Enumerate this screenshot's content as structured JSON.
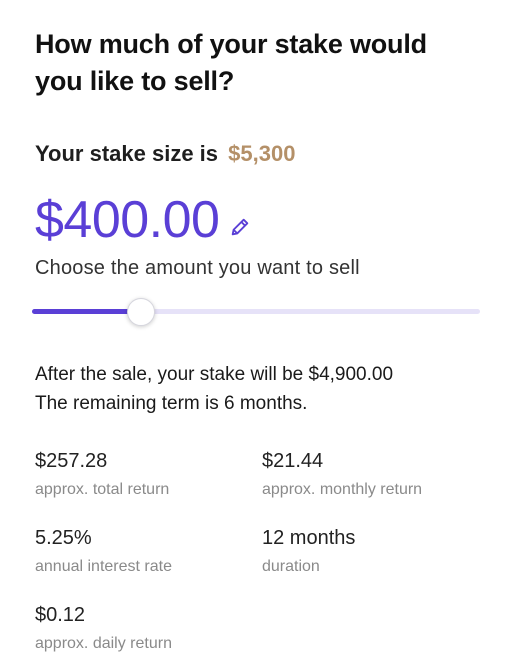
{
  "heading": "How much of your stake would you like to sell?",
  "stake": {
    "label": "Your stake size is",
    "value": "$5,300"
  },
  "amount": {
    "value": "$400.00",
    "edit_icon": "pencil-icon"
  },
  "slider": {
    "label": "Choose the amount you want to sell",
    "fraction": 0.24
  },
  "summary": {
    "line1": "After the sale, your stake will be $4,900.00",
    "line2": "The remaining term is 6 months."
  },
  "stats": [
    {
      "value": "$257.28",
      "label": "approx. total return"
    },
    {
      "value": "$21.44",
      "label": "approx. monthly return"
    },
    {
      "value": "5.25%",
      "label": "annual interest rate"
    },
    {
      "value": "12 months",
      "label": "duration"
    },
    {
      "value": "$0.12",
      "label": "approx. daily return"
    }
  ],
  "colors": {
    "accent": "#5a3fd6",
    "stake_value": "#b49068",
    "track": "#e6e2f8"
  }
}
